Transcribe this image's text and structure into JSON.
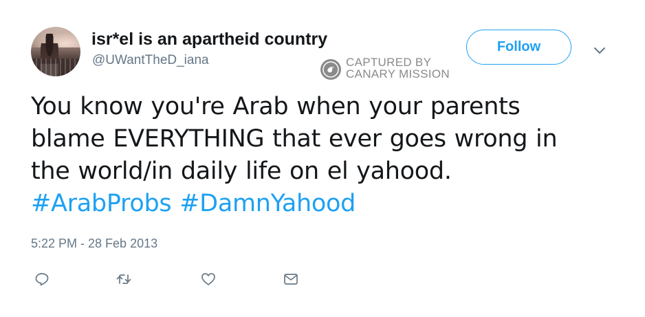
{
  "user": {
    "display_name": "isr*el is an apartheid country",
    "handle": "@UWantTheD_iana",
    "avatar_icon": "profile-photo"
  },
  "watermark": {
    "line1": "CAPTURED BY",
    "line2": "CANARY MISSION",
    "icon": "canary-bird-icon"
  },
  "header": {
    "follow_label": "Follow",
    "menu_icon": "chevron-down-icon"
  },
  "tweet": {
    "text_lines": [
      "You know you're Arab when your parents",
      "blame EVERYTHING that ever goes wrong in",
      "the world/in daily life on el yahood."
    ],
    "hashtags": [
      "#ArabProbs",
      "#DamnYahood"
    ],
    "timestamp": "5:22 PM - 28 Feb 2013"
  },
  "actions": [
    {
      "name": "reply",
      "icon": "reply-icon"
    },
    {
      "name": "retweet",
      "icon": "retweet-icon"
    },
    {
      "name": "like",
      "icon": "heart-icon"
    },
    {
      "name": "message",
      "icon": "envelope-icon"
    }
  ],
  "colors": {
    "accent": "#1da1f2",
    "text": "#14171a",
    "muted": "#657786",
    "watermark": "#8a8a8a"
  }
}
